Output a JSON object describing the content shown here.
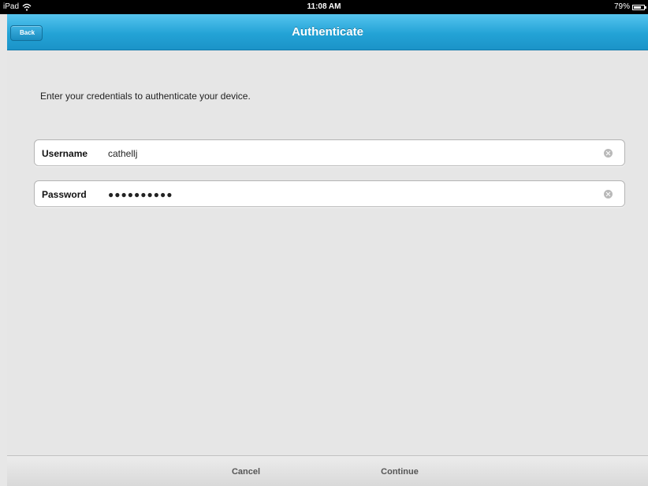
{
  "status_bar": {
    "device": "iPad",
    "time": "11:08 AM",
    "battery": "79%",
    "battery_level": 0.79,
    "wifi_icon": "wifi-icon",
    "battery_icon": "battery-icon"
  },
  "nav": {
    "back_label": "Back",
    "title": "Authenticate"
  },
  "form": {
    "instructions": "Enter your credentials to authenticate your device.",
    "username": {
      "label": "Username",
      "value": "cathellj",
      "clear_icon": "clear-icon"
    },
    "password": {
      "label": "Password",
      "value": "●●●●●●●●●●",
      "clear_icon": "clear-icon"
    }
  },
  "toolbar": {
    "cancel_label": "Cancel",
    "continue_label": "Continue"
  },
  "colors": {
    "nav_bar": "#23a3d6",
    "background": "#e6e6e6"
  }
}
